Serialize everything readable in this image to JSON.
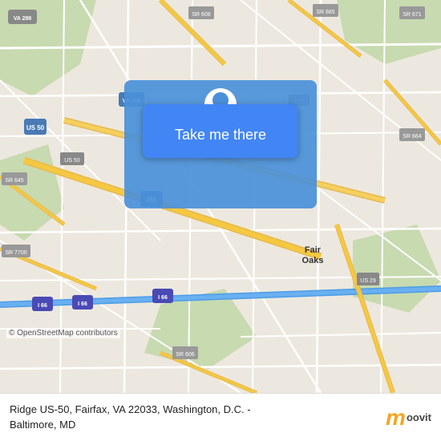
{
  "map": {
    "background_color": "#e8e0d8",
    "road_color": "#ffffff",
    "highway_color": "#f5c842",
    "highway_border": "#e0a800",
    "green_area": "#c8dab0",
    "water_color": "#b8d4e8"
  },
  "button": {
    "label": "Take me there",
    "bg_color": "#4a90d9"
  },
  "bottom_bar": {
    "address_line1": "Ridge US-50, Fairfax, VA 22033, Washington, D.C. -",
    "address_line2": "Baltimore, MD",
    "copyright": "© OpenStreetMap contributors"
  },
  "pin": {
    "icon": "📍"
  },
  "moovit": {
    "logo_letter": "m",
    "logo_text": "moovit"
  }
}
